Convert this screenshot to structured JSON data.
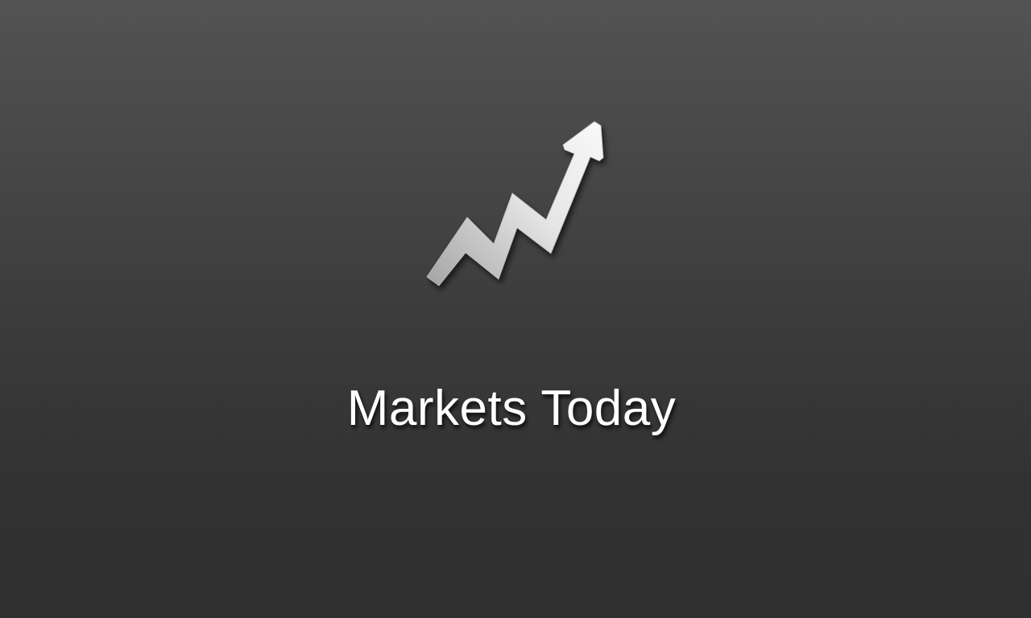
{
  "splash": {
    "title": "Markets Today",
    "icon": "trending-up-arrow-icon",
    "colors": {
      "background_top": "#535353",
      "background_bottom": "#303030",
      "text": "#ffffff",
      "icon_light": "#f8f8f8",
      "icon_dark": "#a6a6a6"
    }
  }
}
